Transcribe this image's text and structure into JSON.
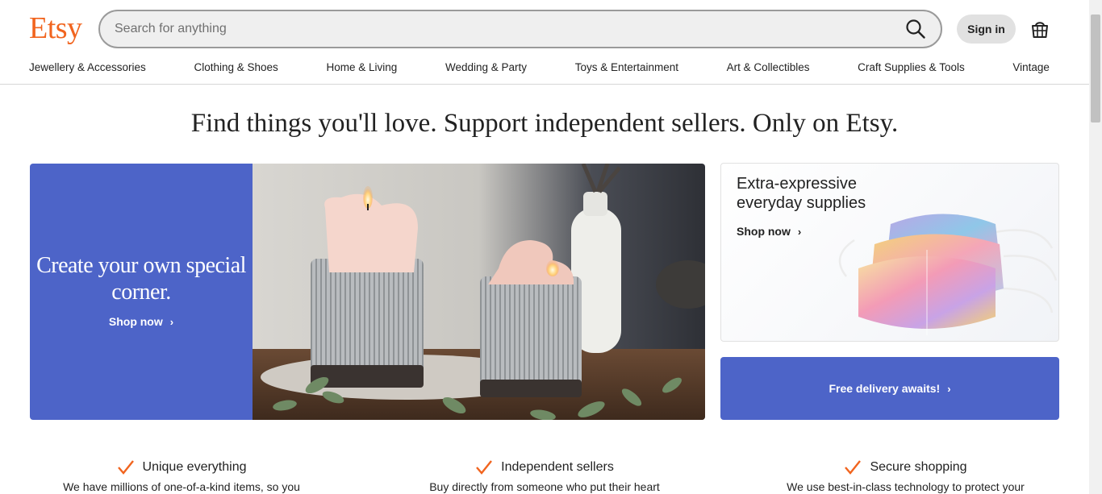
{
  "brand": {
    "logo_text": "Etsy",
    "accent": "#f1641e",
    "banner_blue": "#4d64c8"
  },
  "search": {
    "placeholder": "Search for anything",
    "value": "",
    "icon": "search-icon"
  },
  "header": {
    "signin_label": "Sign in",
    "cart_icon": "basket-icon"
  },
  "nav": {
    "items": [
      {
        "label": "Jewellery & Accessories"
      },
      {
        "label": "Clothing & Shoes"
      },
      {
        "label": "Home & Living"
      },
      {
        "label": "Wedding & Party"
      },
      {
        "label": "Toys & Entertainment"
      },
      {
        "label": "Art & Collectibles"
      },
      {
        "label": "Craft Supplies & Tools"
      },
      {
        "label": "Vintage"
      }
    ]
  },
  "hero": {
    "tagline": "Find things you'll love. Support independent sellers. Only on Etsy.",
    "main_banner": {
      "title": "Create your own special corner.",
      "cta": "Shop now"
    },
    "side_card": {
      "title": "Extra-expressive everyday supplies",
      "cta": "Shop now"
    },
    "delivery_card": {
      "label": "Free delivery awaits!"
    }
  },
  "value_props": [
    {
      "title": "Unique everything",
      "desc": "We have millions of one-of-a-kind items, so you"
    },
    {
      "title": "Independent sellers",
      "desc": "Buy directly from someone who put their heart"
    },
    {
      "title": "Secure shopping",
      "desc": "We use best-in-class technology to protect your"
    }
  ]
}
